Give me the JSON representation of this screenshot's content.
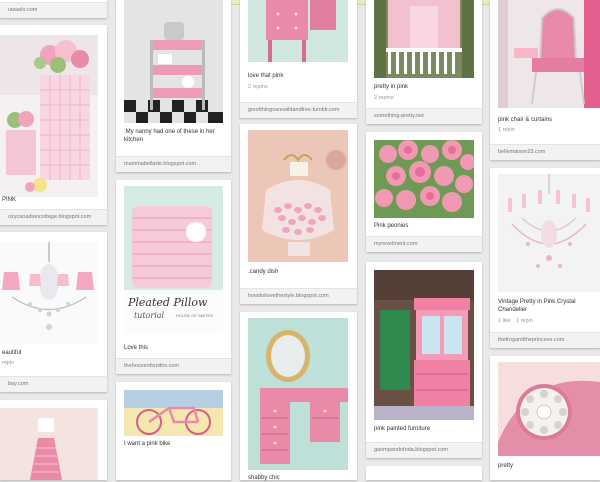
{
  "pins": {
    "c1_top": {
      "source": "uwaelo.com"
    },
    "c1_pink": {
      "caption": "PINK",
      "source": "ozycanadiancottage.blogspot.com"
    },
    "c1_chand": {
      "caption": "eautiful",
      "repins": "repin",
      "source": "bay.com"
    },
    "c2_cart": {
      "caption": ":My nanny had one of these in her kitchen",
      "source": "mammabellarte.blogspot.com"
    },
    "c2_pillow": {
      "overlay_title": "Pleated Pillow",
      "overlay_sub": "tutorial",
      "overlay_brand": "HOUSE OF SMITHS",
      "caption": "Love this",
      "source": "thehouseofsmiths.com"
    },
    "c3_vanity": {
      "caption": "love that pink",
      "repins": "2 repins",
      "source": "goodthingsarewildandfree.tumblr.com"
    },
    "c3_candy": {
      "caption": ".candy dish",
      "source": "howdoilovethestyle.blogspot.com"
    },
    "c3_dresser": {
      "caption": "shabby chic"
    },
    "c4_porch": {
      "caption": "pretty in pink",
      "repins": "2 repins",
      "source": "something-pretty.net"
    },
    "c4_peony": {
      "caption": "Pink peonies",
      "source": "myrevelment.com"
    },
    "c4_furn": {
      "caption": "pink painted furniture",
      "source": "garimpandofrida.blogspot.com"
    },
    "c5_chair": {
      "caption": "pink chair & curtains",
      "repins": "1 repin",
      "source": "bellemaison23.com"
    },
    "c5_chand": {
      "caption": "Vintage Pretty in Pink Crystal Chandelier",
      "likes": "1 like",
      "repins": "1 repin",
      "source": "thefrogandtheprincess.com"
    },
    "c5_phone": {
      "caption": "pretty"
    },
    "c2_bike": {
      "caption": "I want a pink bike"
    }
  },
  "colors": {
    "background": "#e9e9e9",
    "card": "#ffffff",
    "source_bar": "#f2f2f2",
    "pink_light": "#f4c6d4",
    "pink_mid": "#e98aa8",
    "pink_dark": "#d9577f"
  }
}
